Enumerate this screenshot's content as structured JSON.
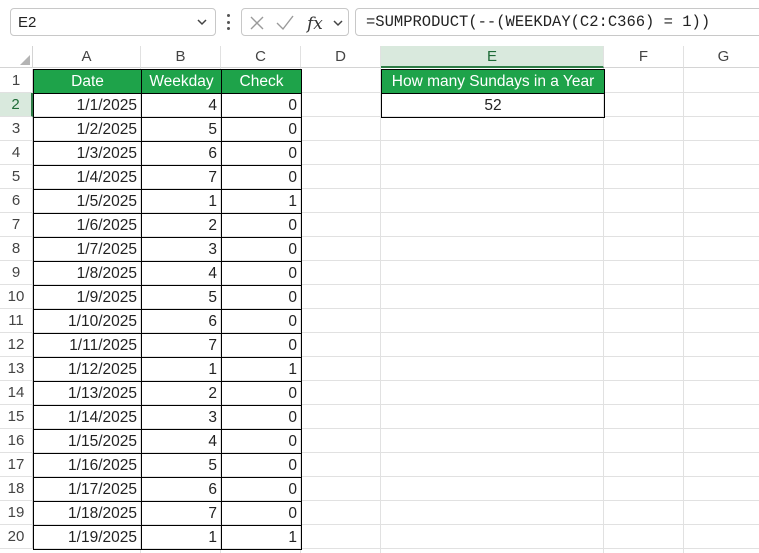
{
  "formula_bar": {
    "name_box": "E2",
    "formula": "=SUMPRODUCT(--(WEEKDAY(C2:C366) = 1))"
  },
  "columns": [
    "A",
    "B",
    "C",
    "D",
    "E",
    "F",
    "G"
  ],
  "selected_column": "E",
  "selected_row": "2",
  "rows": [
    "1",
    "2",
    "3",
    "4",
    "5",
    "6",
    "7",
    "8",
    "9",
    "10",
    "11",
    "12",
    "13",
    "14",
    "15",
    "16",
    "17",
    "18",
    "19",
    "20"
  ],
  "table": {
    "headers": [
      "Date",
      "Weekday",
      "Check"
    ],
    "data": [
      [
        "1/1/2025",
        "4",
        "0"
      ],
      [
        "1/2/2025",
        "5",
        "0"
      ],
      [
        "1/3/2025",
        "6",
        "0"
      ],
      [
        "1/4/2025",
        "7",
        "0"
      ],
      [
        "1/5/2025",
        "1",
        "1"
      ],
      [
        "1/6/2025",
        "2",
        "0"
      ],
      [
        "1/7/2025",
        "3",
        "0"
      ],
      [
        "1/8/2025",
        "4",
        "0"
      ],
      [
        "1/9/2025",
        "5",
        "0"
      ],
      [
        "1/10/2025",
        "6",
        "0"
      ],
      [
        "1/11/2025",
        "7",
        "0"
      ],
      [
        "1/12/2025",
        "1",
        "1"
      ],
      [
        "1/13/2025",
        "2",
        "0"
      ],
      [
        "1/14/2025",
        "3",
        "0"
      ],
      [
        "1/15/2025",
        "4",
        "0"
      ],
      [
        "1/16/2025",
        "5",
        "0"
      ],
      [
        "1/17/2025",
        "6",
        "0"
      ],
      [
        "1/18/2025",
        "7",
        "0"
      ],
      [
        "1/19/2025",
        "1",
        "1"
      ]
    ]
  },
  "result": {
    "header": "How many Sundays in a Year",
    "value": "52"
  },
  "icons": {
    "name_box_dropdown": "chevron-down-icon",
    "more": "vertical-dots-icon",
    "cancel": "close-icon",
    "enter": "checkmark-icon",
    "function": "fx-icon",
    "fx_dropdown": "chevron-down-icon"
  },
  "colors": {
    "header_green": "#1ea34a",
    "selected_header_bg": "#d9e9dd",
    "selected_header_accent": "#2e7d46"
  }
}
